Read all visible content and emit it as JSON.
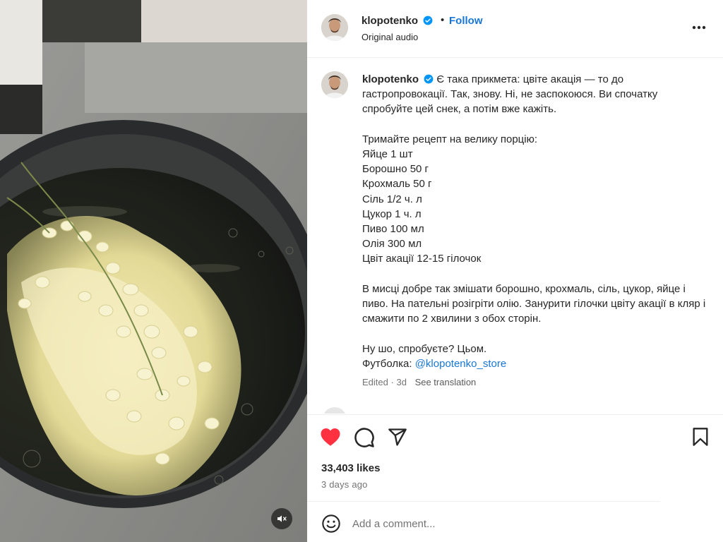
{
  "post": {
    "username": "klopotenko",
    "separator": "•",
    "follow_label": "Follow",
    "audio_label": "Original audio"
  },
  "caption": {
    "username": "klopotenko",
    "lines": [
      "Є така прикмета: цвіте акація — то до гастропровокації. Так, знову. Ні, не заспокоюся. Ви спочатку спробуйте цей снек, а потім вже кажіть.",
      "",
      "Тримайте рецепт на велику порцію:",
      "Яйце 1 шт",
      "Борошно 50 г",
      "Крохмаль 50 г",
      "Сіль 1/2 ч. л",
      "Цукор 1 ч. л",
      "Пиво 100 мл",
      "Олія 300 мл",
      "Цвіт акації 12-15 гілочок",
      "",
      "В мисці добре так змішати борошно, крохмаль, сіль, цукор, яйце і пиво. На пательні розігріти олію. Занурити гілочки цвіту акації в кляр і смажити по 2 хвилини з обох сторін.",
      "",
      "Ну шо, спробуєте? Цьом."
    ],
    "shirt_label": "Футболка: ",
    "shirt_mention": "@klopotenko_store",
    "edited_label": "Edited",
    "meta_separator": "·",
    "age": "3d",
    "see_translation": "See translation"
  },
  "engagement": {
    "likes_text": "33,403 likes",
    "time_ago": "3 days ago",
    "liked": true
  },
  "comment_box": {
    "placeholder": "Add a comment..."
  },
  "colors": {
    "like_red": "#ff3040",
    "link_blue": "#1877d6",
    "verified_blue": "#0095f6",
    "muted_text": "#737373"
  },
  "icons": {
    "like": "heart-icon",
    "comment": "comment-bubble-icon",
    "share": "paper-plane-icon",
    "save": "bookmark-icon",
    "more": "more-horizontal-icon",
    "verified": "verified-badge-icon",
    "emoji": "emoji-icon",
    "mute": "speaker-muted-icon"
  }
}
